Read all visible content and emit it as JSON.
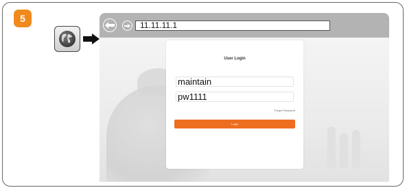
{
  "step": {
    "number": "5"
  },
  "browser": {
    "address": "11.11.11.1"
  },
  "login": {
    "title": "User Login",
    "username_value": "maintain",
    "password_value": "pw1111",
    "forgot_label": "Forgot Password",
    "login_label": "Login"
  },
  "colors": {
    "accent": "#f08a1c",
    "login_button": "#ee6e1f",
    "browser_bar": "#b3b3b3"
  },
  "icons": [
    "globe-icon",
    "arrow-right-icon",
    "back-arrow-icon",
    "forward-circle-icon"
  ]
}
